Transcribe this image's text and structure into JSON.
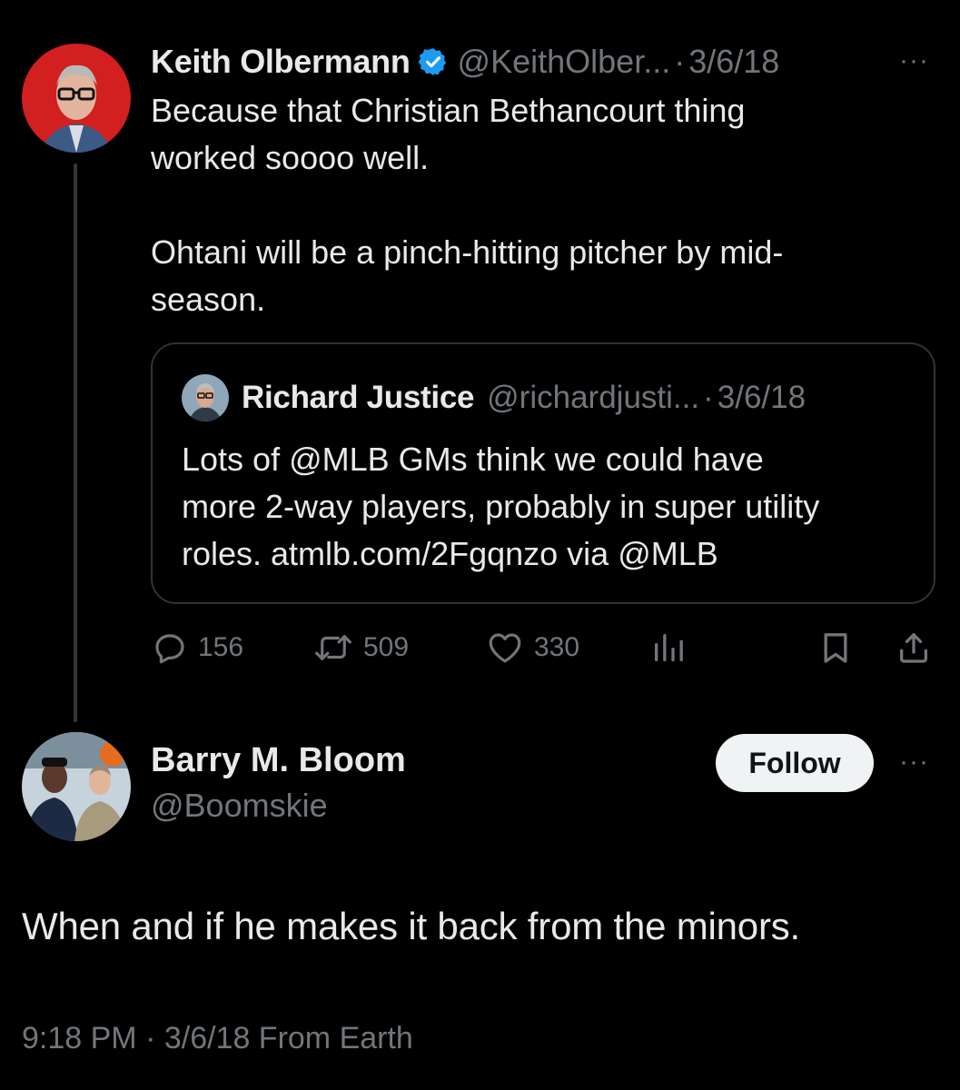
{
  "parent_tweet": {
    "author_name": "Keith Olbermann",
    "handle": "@KeithOlber...",
    "date": "3/6/18",
    "text": "Because that Christian Bethancourt thing\nworked soooo well.\n\nOhtani will be a pinch-hitting pitcher by mid-\nseason.",
    "more_icon": "···",
    "quoted_tweet": {
      "author_name": "Richard Justice",
      "handle": "@richardjusti...",
      "date": "3/6/18",
      "text": "Lots of @MLB GMs think we could have\nmore 2-way players, probably in super utility\nroles.  atmlb.com/2Fgqnzo via @MLB"
    },
    "actions": {
      "replies": "156",
      "retweets": "509",
      "likes": "330"
    },
    "icons": [
      "verified-badge-icon",
      "reply-icon",
      "retweet-icon",
      "like-icon",
      "views-icon",
      "bookmark-icon",
      "share-icon"
    ]
  },
  "reply": {
    "author_name": "Barry M. Bloom",
    "handle": "@Boomskie",
    "follow_label": "Follow",
    "more_icon": "···",
    "text": "When and if he makes it back from the minors.",
    "meta": "9:18 PM · 3/6/18 From Earth"
  },
  "colors": {
    "background": "#000000",
    "text_primary": "#e7e9ea",
    "text_secondary": "#71767b",
    "verified_blue": "#1d9bf0",
    "border": "#2f3336",
    "follow_bg": "#eff3f4"
  }
}
